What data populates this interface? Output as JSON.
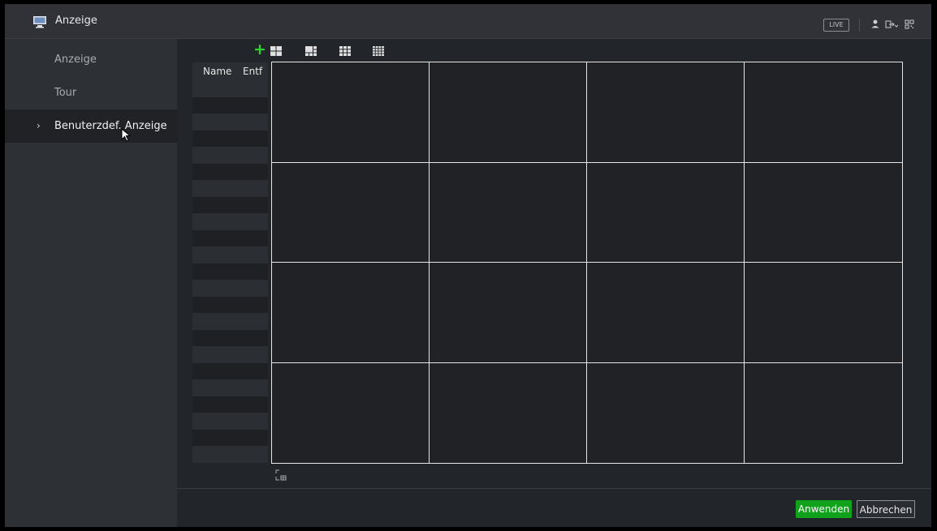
{
  "window": {
    "title": "Anzeige",
    "icon": "monitor-icon"
  },
  "titlebar": {
    "live_label": "LIVE",
    "icons": [
      "user-icon",
      "logout-icon",
      "qr-code-icon"
    ]
  },
  "sidebar": {
    "items": [
      {
        "label": "Anzeige",
        "active": false
      },
      {
        "label": "Tour",
        "active": false
      },
      {
        "label": "Benuterzdef. Anzeige",
        "active": true
      }
    ]
  },
  "toolbar": {
    "add_icon": "plus-icon",
    "layouts": [
      "layout-4-icon",
      "layout-6-icon",
      "layout-9-icon",
      "layout-16-icon"
    ]
  },
  "list": {
    "col_name": "Name",
    "col_delete": "Entf"
  },
  "grid": {
    "rows": 4,
    "cols": 4
  },
  "footer": {
    "apply_label": "Anwenden",
    "cancel_label": "Abbrechen"
  },
  "colors": {
    "accent": "#10a21a",
    "add_green": "#2fd42f",
    "background": "#22252a",
    "sidebar": "#2d3035"
  }
}
